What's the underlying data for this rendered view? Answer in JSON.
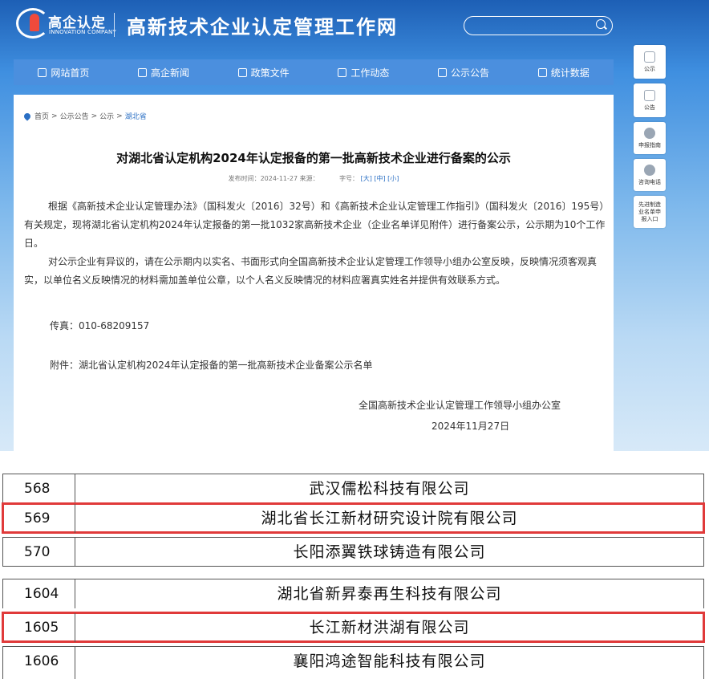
{
  "header": {
    "logo_text": "高企认定",
    "logo_sub": "INNOVATION COMPANY",
    "site_title": "高新技术企业认定管理工作网"
  },
  "nav": [
    {
      "label": "网站首页",
      "icon": "home-icon"
    },
    {
      "label": "高企新闻",
      "icon": "news-icon"
    },
    {
      "label": "政策文件",
      "icon": "document-icon"
    },
    {
      "label": "工作动态",
      "icon": "send-icon"
    },
    {
      "label": "公示公告",
      "icon": "notice-icon"
    },
    {
      "label": "统计数据",
      "icon": "chart-icon"
    }
  ],
  "breadcrumb": {
    "items": [
      "首页",
      "公示公告",
      "公示"
    ],
    "current": "湖北省",
    "sep": ">"
  },
  "article": {
    "title": "对湖北省认定机构2024年认定报备的第一批高新技术企业进行备案的公示",
    "meta_date": "发布时间：2024-11-27 来源：",
    "meta_size_label": "字号：",
    "meta_sizes": "[大] [中] [小]",
    "para1": "根据《高新技术企业认定管理办法》（国科发火〔2016〕32号）和《高新技术企业认定管理工作指引》（国科发火〔2016〕195号）有关规定，现将湖北省认定机构2024年认定报备的第一批1032家高新技术企业（企业名单详见附件）进行备案公示，公示期为10个工作日。",
    "para2": "对公示企业有异议的，请在公示期内以实名、书面形式向全国高新技术企业认定管理工作领导小组办公室反映，反映情况须客观真实，以单位名义反映情况的材料需加盖单位公章，以个人名义反映情况的材料应署真实姓名并提供有效联系方式。",
    "fax": "传真：010-68209157",
    "attachment": "附件：湖北省认定机构2024年认定报备的第一批高新技术企业备案公示名单",
    "signature_org": "全国高新技术企业认定管理工作领导小组办公室",
    "signature_date": "2024年11月27日"
  },
  "sidebar": [
    {
      "label": "公示",
      "icon": "board-icon"
    },
    {
      "label": "公告",
      "icon": "clipboard-icon"
    },
    {
      "label": "申报指南",
      "icon": "compass-icon"
    },
    {
      "label": "咨询电话",
      "icon": "phone-icon"
    },
    {
      "label": "先进制造业名单申报入口",
      "icon": ""
    }
  ],
  "table_top": [
    {
      "no": "568",
      "name": "武汉儒松科技有限公司",
      "highlight": false
    },
    {
      "no": "569",
      "name": "湖北省长江新材研究设计院有限公司",
      "highlight": true
    },
    {
      "no": "570",
      "name": "长阳添翼铁球铸造有限公司",
      "highlight": false
    }
  ],
  "table_bottom": [
    {
      "no": "1604",
      "name": "湖北省新昇泰再生科技有限公司",
      "highlight": false
    },
    {
      "no": "1605",
      "name": "长江新材洪湖有限公司",
      "highlight": true
    },
    {
      "no": "1606",
      "name": "襄阳鸿途智能科技有限公司",
      "highlight": false
    }
  ]
}
